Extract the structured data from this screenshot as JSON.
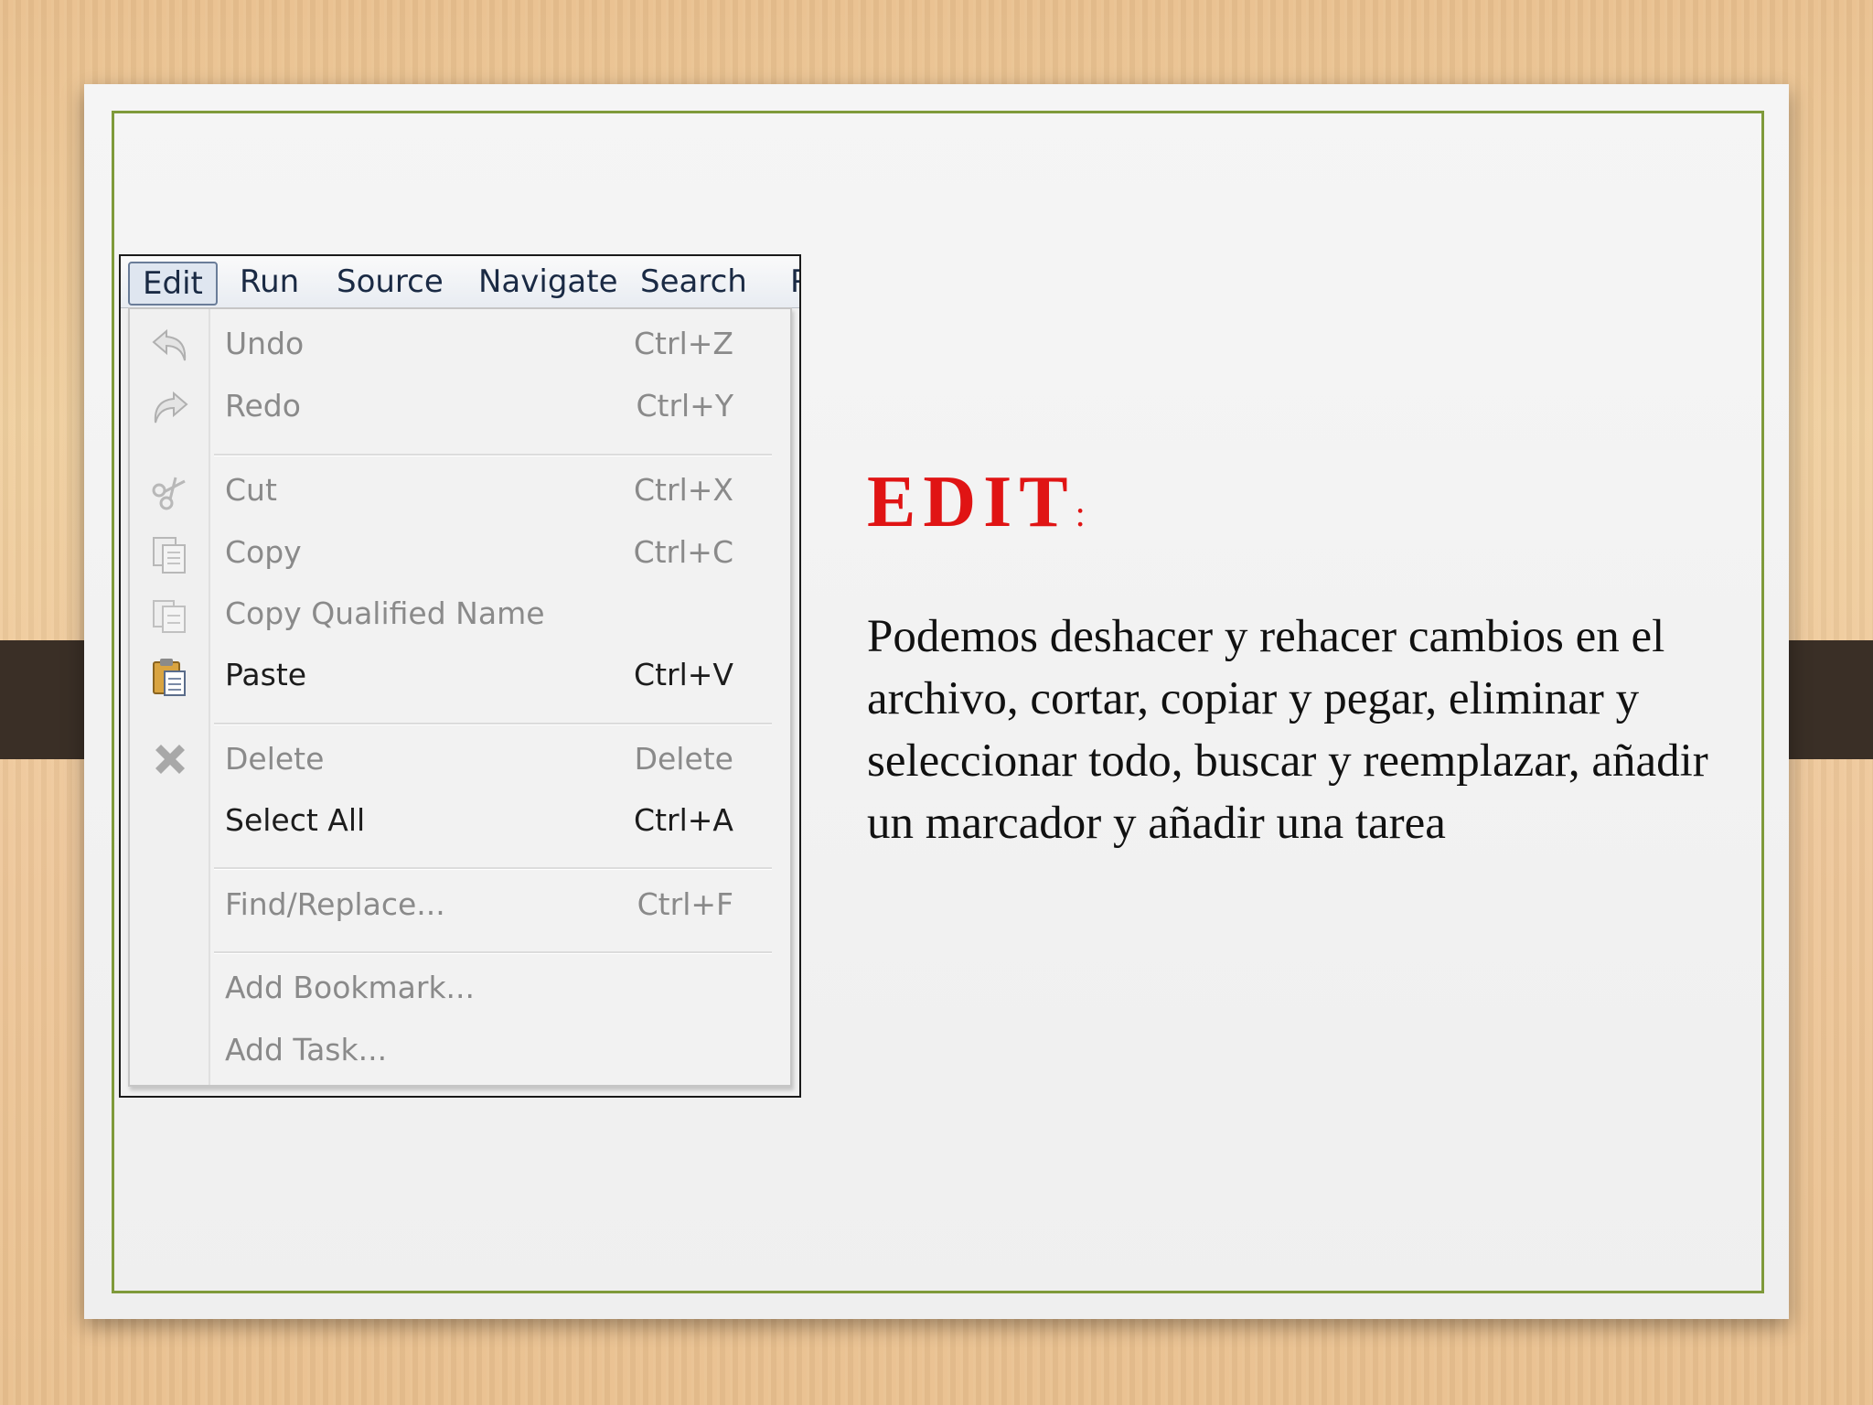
{
  "menubar": {
    "items": [
      "Edit",
      "Run",
      "Source",
      "Navigate",
      "Search",
      "P"
    ]
  },
  "edit_menu": {
    "items": [
      {
        "label": "Undo",
        "shortcut": "Ctrl+Z",
        "icon": "undo-icon",
        "enabled": false
      },
      {
        "label": "Redo",
        "shortcut": "Ctrl+Y",
        "icon": "redo-icon",
        "enabled": false
      },
      {
        "label": "Cut",
        "shortcut": "Ctrl+X",
        "icon": "scissors-icon",
        "enabled": false
      },
      {
        "label": "Copy",
        "shortcut": "Ctrl+C",
        "icon": "copy-icon",
        "enabled": false
      },
      {
        "label": "Copy Qualified Name",
        "shortcut": "",
        "icon": "copy-qualified-name-icon",
        "enabled": false
      },
      {
        "label": "Paste",
        "shortcut": "Ctrl+V",
        "icon": "paste-icon",
        "enabled": true
      },
      {
        "label": "Delete",
        "shortcut": "Delete",
        "icon": "delete-x-icon",
        "enabled": false
      },
      {
        "label": "Select All",
        "shortcut": "Ctrl+A",
        "icon": "",
        "enabled": true
      },
      {
        "label": "Find/Replace...",
        "shortcut": "Ctrl+F",
        "icon": "",
        "enabled": false
      },
      {
        "label": "Add Bookmark...",
        "shortcut": "",
        "icon": "",
        "enabled": false
      },
      {
        "label": "Add Task...",
        "shortcut": "",
        "icon": "",
        "enabled": false
      }
    ]
  },
  "slide": {
    "heading": "EDIT",
    "heading_suffix": ":",
    "body": "Podemos deshacer y rehacer  cambios en el archivo, cortar, copiar y pegar, eliminar y seleccionar todo, buscar y reemplazar, añadir un marcador y añadir una tarea"
  },
  "colors": {
    "heading": "#e01414",
    "slide_border": "#7f9a3a",
    "strap": "#3a2f26"
  }
}
